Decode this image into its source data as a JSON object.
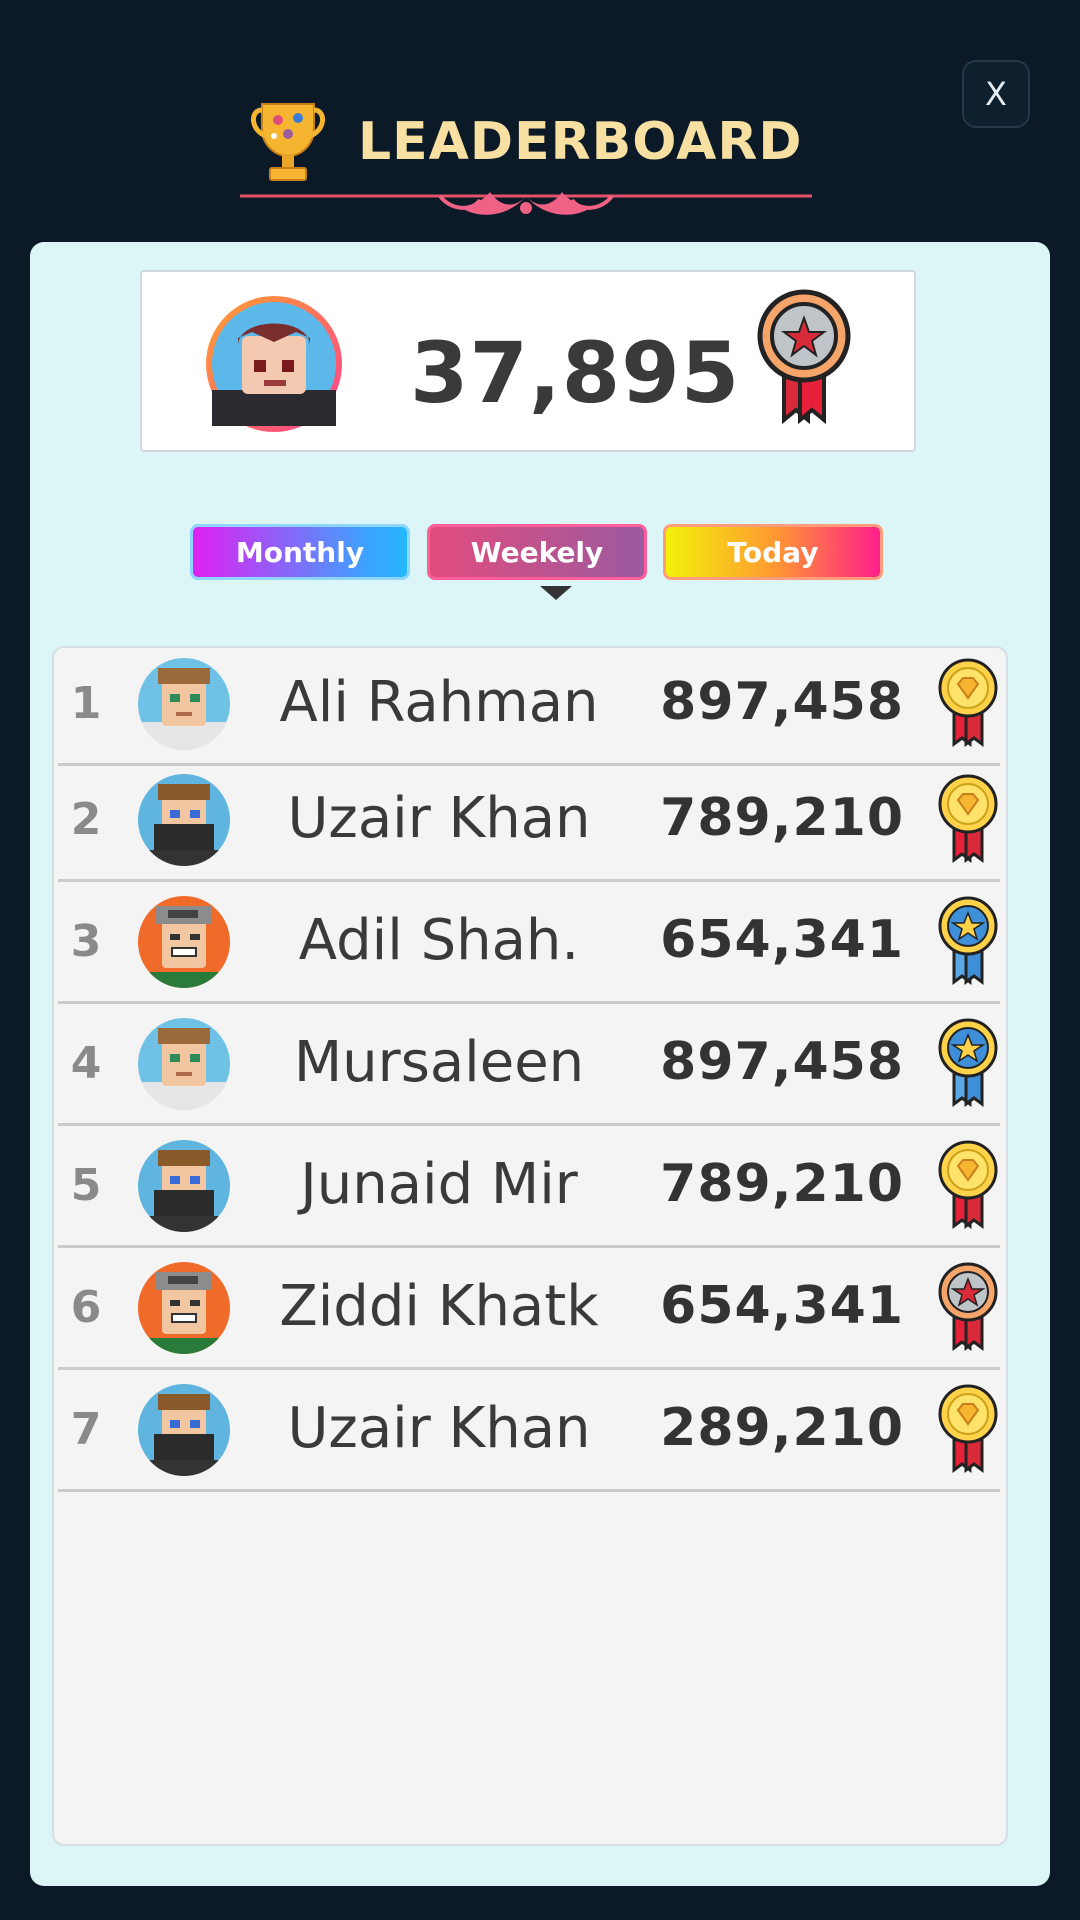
{
  "header": {
    "title": "LEADERBOARD",
    "close_label": "X"
  },
  "me": {
    "score": "37,895",
    "medal": "silver-star"
  },
  "tabs": [
    {
      "label": "Monthly"
    },
    {
      "label": "Weekely"
    },
    {
      "label": "Today"
    }
  ],
  "selected_tab": "Weekely",
  "players": [
    {
      "rank": "1",
      "name": "Ali Rahman",
      "score": "897,458",
      "avatar": "hoodie",
      "medal": "gold-diamond"
    },
    {
      "rank": "2",
      "name": "Uzair Khan",
      "score": "789,210",
      "avatar": "masked",
      "medal": "gold-diamond"
    },
    {
      "rank": "3",
      "name": "Adil Shah.",
      "score": "654,341",
      "avatar": "cap",
      "medal": "blue-star"
    },
    {
      "rank": "4",
      "name": "Mursaleen",
      "score": "897,458",
      "avatar": "hoodie",
      "medal": "blue-star"
    },
    {
      "rank": "5",
      "name": "Junaid Mir",
      "score": "789,210",
      "avatar": "masked",
      "medal": "gold-diamond"
    },
    {
      "rank": "6",
      "name": "Ziddi Khatk",
      "score": "654,341",
      "avatar": "cap",
      "medal": "silver-star"
    },
    {
      "rank": "7",
      "name": "Uzair Khan",
      "score": "289,210",
      "avatar": "masked",
      "medal": "gold-diamond"
    }
  ],
  "colors": {
    "background": "#0b1a26",
    "panel": "#dcf6f8",
    "title": "#f7e0a2",
    "ribbon": "#e8213a"
  }
}
